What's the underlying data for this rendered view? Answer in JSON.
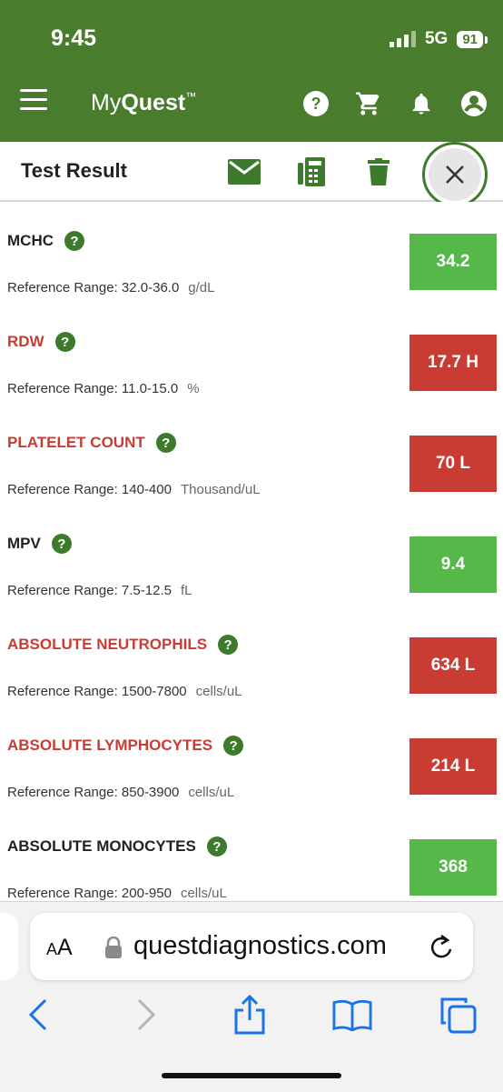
{
  "status": {
    "time": "9:45",
    "network": "5G",
    "battery": "91"
  },
  "app": {
    "brand_light": "My",
    "brand_bold": "Quest",
    "brand_mark": "™"
  },
  "subheader": {
    "title": "Test Result"
  },
  "results": [
    {
      "name": "MCHC",
      "ref_label": "Reference Range: 32.0-36.0",
      "unit": "g/dL",
      "value": "34.2",
      "status": "normal"
    },
    {
      "name": "RDW",
      "ref_label": "Reference Range: 11.0-15.0",
      "unit": "%",
      "value": "17.7 H",
      "status": "abnormal"
    },
    {
      "name": "PLATELET COUNT",
      "ref_label": "Reference Range: 140-400",
      "unit": "Thousand/uL",
      "value": "70 L",
      "status": "abnormal"
    },
    {
      "name": "MPV",
      "ref_label": "Reference Range: 7.5-12.5",
      "unit": "fL",
      "value": "9.4",
      "status": "normal"
    },
    {
      "name": "ABSOLUTE NEUTROPHILS",
      "ref_label": "Reference Range: 1500-7800",
      "unit": "cells/uL",
      "value": "634 L",
      "status": "abnormal"
    },
    {
      "name": "ABSOLUTE LYMPHOCYTES",
      "ref_label": "Reference Range: 850-3900",
      "unit": "cells/uL",
      "value": "214 L",
      "status": "abnormal"
    },
    {
      "name": "ABSOLUTE MONOCYTES",
      "ref_label": "Reference Range: 200-950",
      "unit": "cells/uL",
      "value": "368",
      "status": "normal"
    }
  ],
  "help_glyph": "?",
  "browser": {
    "aa_small": "A",
    "aa_large": "A",
    "url": "questdiagnostics.com"
  },
  "colors": {
    "header_green": "#4a7c2e",
    "normal": "#55b849",
    "abnormal": "#c83c33"
  }
}
